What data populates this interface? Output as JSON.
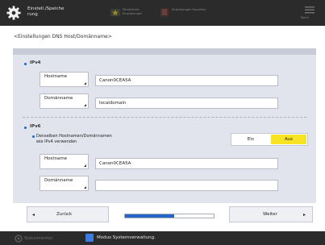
{
  "header": {
    "title_line1": "Einstell./Speiche",
    "title_line2": "rung",
    "shortcut1": "Persönliche Einstellungen",
    "shortcut2": "Einstellungen Favoriten",
    "menu": "Menü"
  },
  "breadcrumb": "<Einstellungen DNS Host/Domänname>",
  "ipv4": {
    "label": "IPv4",
    "host_button": "Hostname",
    "host_value": "Canon0CEA5A",
    "domain_button": "Domänname",
    "domain_value": "localdomain"
  },
  "ipv6": {
    "label": "IPv6",
    "same_line1": "Denselben Hostnamen/Domännamen",
    "same_line2": "wie IPv4 verwenden",
    "toggle_on": "Ein",
    "toggle_off": "Aus",
    "toggle_selected": "Aus",
    "host_button": "Hostname",
    "host_value": "Canon0CEA5A",
    "domain_button": "Domänname",
    "domain_value": ""
  },
  "nav": {
    "back": "Zurück",
    "next": "Weiter",
    "progress": 0.55
  },
  "status": {
    "left": "Statusmonitor",
    "message": "Modus Systemverwaltung."
  },
  "colors": {
    "accent_blue": "#2466c8",
    "toggle_selected": "#f7e223",
    "header_bg": "#2b2b2b",
    "panel_bg": "#e1e4ec"
  },
  "icons": [
    "gear-icon",
    "star-icon",
    "bookmark-icon",
    "menu-icon",
    "status-monitor-icon",
    "system-management-icon"
  ]
}
